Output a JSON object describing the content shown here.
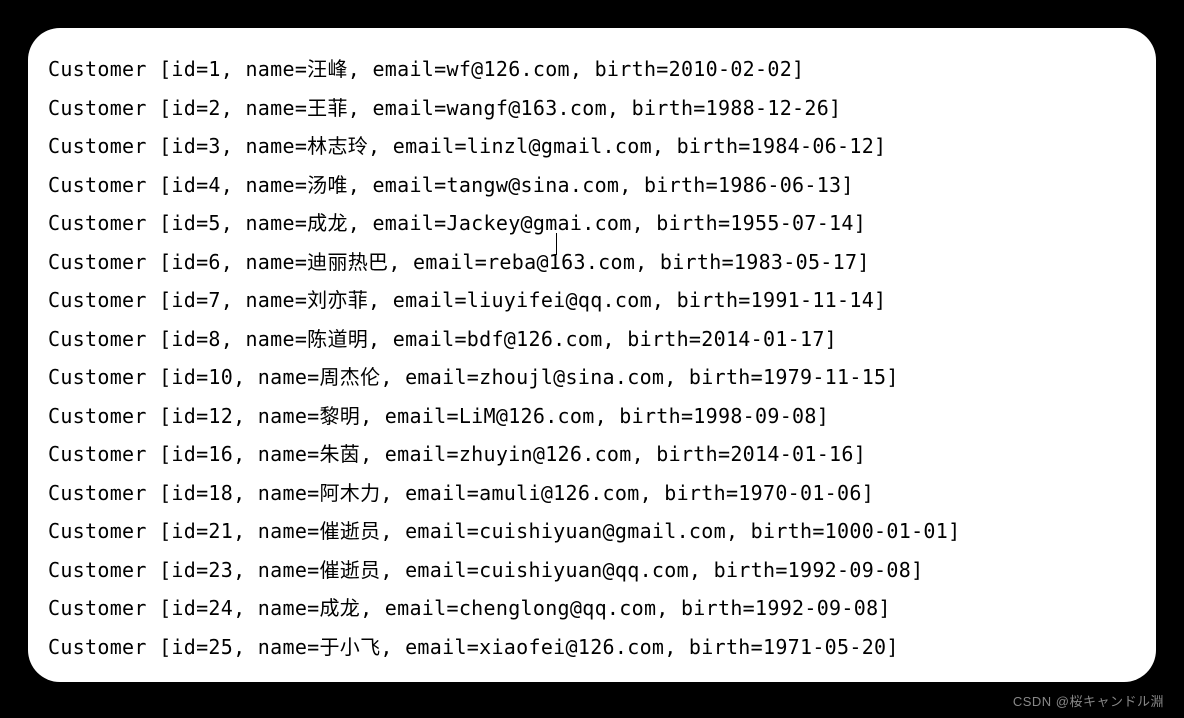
{
  "output": {
    "lines": [
      "Customer [id=1, name=汪峰, email=wf@126.com, birth=2010-02-02]",
      "Customer [id=2, name=王菲, email=wangf@163.com, birth=1988-12-26]",
      "Customer [id=3, name=林志玲, email=linzl@gmail.com, birth=1984-06-12]",
      "Customer [id=4, name=汤唯, email=tangw@sina.com, birth=1986-06-13]",
      "Customer [id=5, name=成龙, email=Jackey@gmai.com, birth=1955-07-14]",
      "Customer [id=6, name=迪丽热巴, email=reba@163.com, birth=1983-05-17]",
      "Customer [id=7, name=刘亦菲, email=liuyifei@qq.com, birth=1991-11-14]",
      "Customer [id=8, name=陈道明, email=bdf@126.com, birth=2014-01-17]",
      "Customer [id=10, name=周杰伦, email=zhoujl@sina.com, birth=1979-11-15]",
      "Customer [id=12, name=黎明, email=LiM@126.com, birth=1998-09-08]",
      "Customer [id=16, name=朱茵, email=zhuyin@126.com, birth=2014-01-16]",
      "Customer [id=18, name=阿木力, email=amuli@126.com, birth=1970-01-06]",
      "Customer [id=21, name=催逝员, email=cuishiyuan@gmail.com, birth=1000-01-01]",
      "Customer [id=23, name=催逝员, email=cuishiyuan@qq.com, birth=1992-09-08]",
      "Customer [id=24, name=成龙, email=chenglong@qq.com, birth=1992-09-08]",
      "Customer [id=25, name=于小飞, email=xiaofei@126.com, birth=1971-05-20]"
    ]
  },
  "watermark": "CSDN @桜キャンドル淵"
}
